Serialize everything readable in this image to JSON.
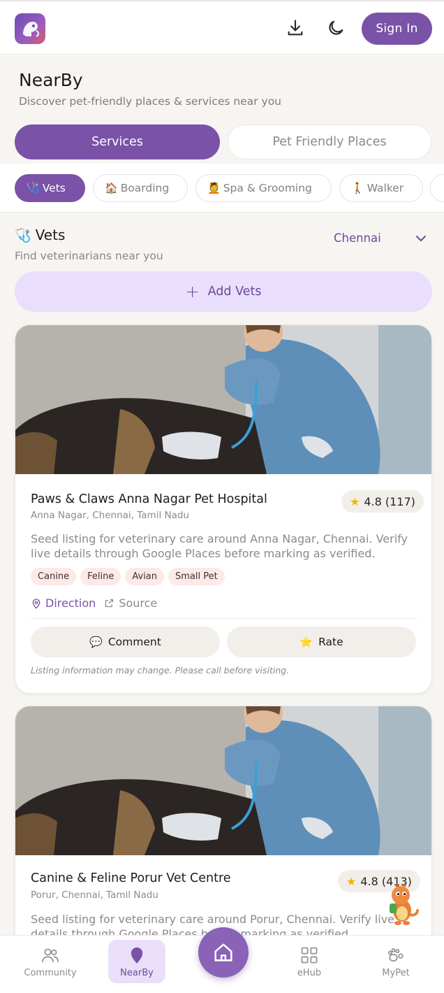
{
  "header": {
    "sign_in_label": "Sign In"
  },
  "page": {
    "title": "NearBy",
    "subtitle": "Discover pet-friendly places & services near you"
  },
  "segments": [
    {
      "label": "Services",
      "active": true
    },
    {
      "label": "Pet Friendly Places",
      "active": false
    }
  ],
  "chips": [
    {
      "emoji": "🩺",
      "label": "Vets",
      "active": true
    },
    {
      "emoji": "🏠",
      "label": "Boarding",
      "active": false
    },
    {
      "emoji": "💆",
      "label": "Spa & Grooming",
      "active": false
    },
    {
      "emoji": "🚶",
      "label": "Walker",
      "active": false
    }
  ],
  "section": {
    "emoji": "🩺",
    "title": "Vets",
    "subtitle": "Find veterinarians near you",
    "city": "Chennai",
    "add_label": "Add Vets"
  },
  "cards": [
    {
      "name": "Paws & Claws Anna Nagar Pet Hospital",
      "rating": "4.8 (117)",
      "location": "Anna Nagar, Chennai, Tamil Nadu",
      "description": "Seed listing for veterinary care around Anna Nagar, Chennai. Verify live details through Google Places before marking as verified.",
      "tags": [
        "Canine",
        "Feline",
        "Avian",
        "Small Pet"
      ],
      "direction_label": "Direction",
      "source_label": "Source",
      "comment_label": "Comment",
      "rate_label": "Rate",
      "disclaimer": "Listing information may change. Please call before visiting."
    },
    {
      "name": "Canine & Feline Porur Vet Centre",
      "rating": "4.8 (413)",
      "location": "Porur, Chennai, Tamil Nadu",
      "description": "Seed listing for veterinary care around Porur, Chennai. Verify live details through Google Places before marking as verified."
    }
  ],
  "bottom_nav": [
    {
      "label": "Community",
      "icon": "community-icon",
      "active": false
    },
    {
      "label": "NearBy",
      "icon": "location-pin-icon",
      "active": true
    },
    {
      "label": "eHub",
      "icon": "grid-icon",
      "active": false
    },
    {
      "label": "MyPet",
      "icon": "paw-icon",
      "active": false
    }
  ],
  "colors": {
    "brand": "#7a52a8",
    "brand_light": "#e9defb",
    "tag_bg": "#fde9e6",
    "star": "#f4b400"
  }
}
